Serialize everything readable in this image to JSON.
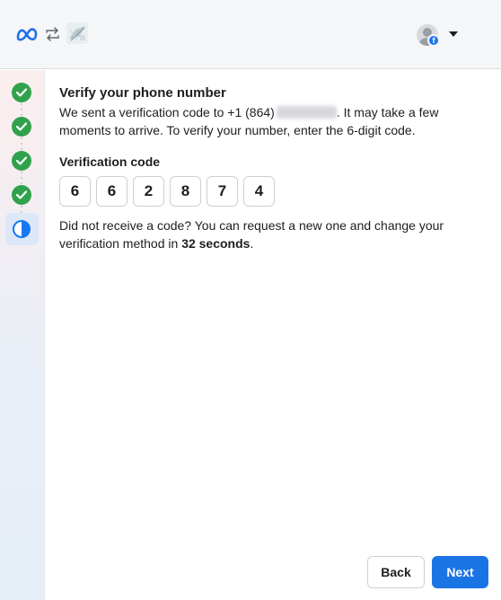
{
  "header": {
    "logo_icon": "meta-logo-icon",
    "swap_icon": "swap-arrows-icon",
    "app_icon": "linked-app-thumbnail",
    "account_icon": "user-avatar-facebook-badge",
    "menu_icon": "caret-down-icon"
  },
  "progress": {
    "completed_steps": 4,
    "current_step": 5,
    "done_color": "#31a24c",
    "current_color": "#1877f2"
  },
  "main": {
    "title": "Verify your phone number",
    "desc_part1": "We sent a verification code to +1 (864)",
    "desc_part2": ". It may take a few moments to arrive. To verify your number, enter the 6-digit code.",
    "code_label": "Verification code",
    "code_digits": [
      "6",
      "6",
      "2",
      "8",
      "7",
      "4"
    ],
    "resend_part1": "Did not receive a code? You can request a new one and change your verification method in ",
    "resend_seconds": "32 seconds",
    "resend_part2": "."
  },
  "footer": {
    "back_label": "Back",
    "next_label": "Next",
    "accent": "#1b74e4"
  }
}
